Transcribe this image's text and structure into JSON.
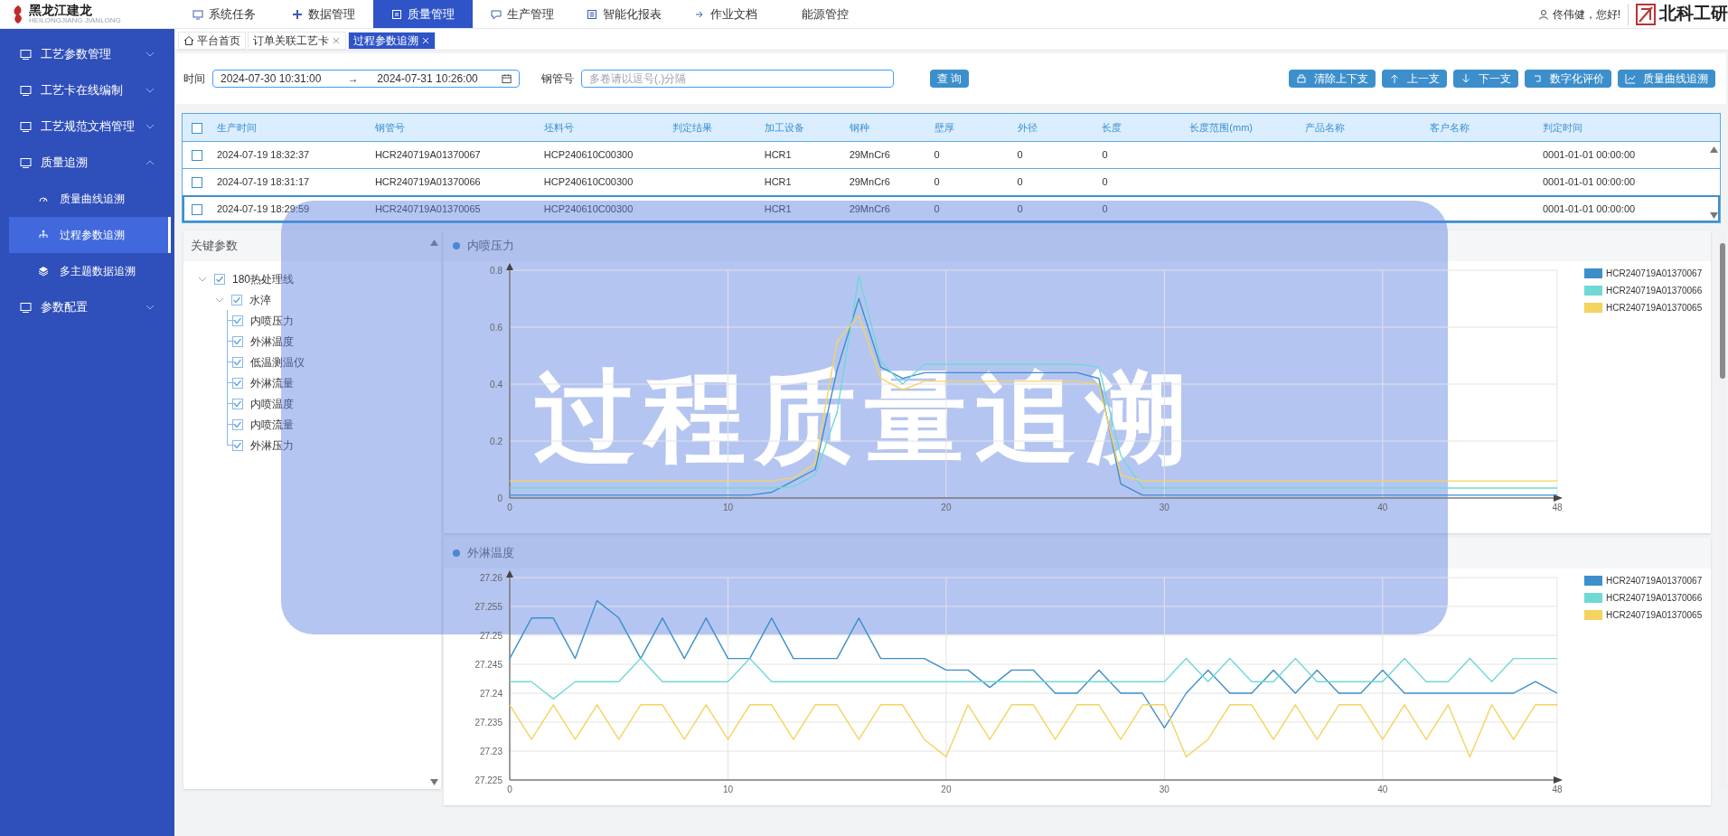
{
  "header": {
    "logo_text": "黑龙江建龙",
    "logo_subtitle": "HEILONGJIANG JIANLONG",
    "nav": [
      {
        "label": "系统任务",
        "has_icon": true,
        "selected": false
      },
      {
        "label": "数据管理",
        "has_icon": true,
        "selected": false
      },
      {
        "label": "质量管理",
        "has_icon": true,
        "selected": true
      },
      {
        "label": "生产管理",
        "has_icon": true,
        "selected": false
      },
      {
        "label": "智能化报表",
        "has_icon": true,
        "selected": false
      },
      {
        "label": "作业文档",
        "has_icon": true,
        "selected": false
      },
      {
        "label": "能源管控",
        "has_icon": false,
        "selected": false
      }
    ],
    "user_greeting": "佟伟健，您好!",
    "brand_text": "北科工研"
  },
  "sidebar": {
    "items": [
      {
        "label": "工艺参数管理",
        "expanded": false
      },
      {
        "label": "工艺卡在线编制",
        "expanded": false
      },
      {
        "label": "工艺规范文档管理",
        "expanded": false
      },
      {
        "label": "质量追溯",
        "expanded": true,
        "children": [
          {
            "label": "质量曲线追溯",
            "selected": false
          },
          {
            "label": "过程参数追溯",
            "selected": true
          },
          {
            "label": "多主题数据追溯",
            "selected": false
          }
        ]
      },
      {
        "label": "参数配置",
        "expanded": false
      }
    ]
  },
  "tabs": [
    {
      "label": "平台首页",
      "kind": "home",
      "selected": false
    },
    {
      "label": "订单关联工艺卡",
      "kind": "closable",
      "selected": false
    },
    {
      "label": "过程参数追溯",
      "kind": "closable",
      "selected": true
    }
  ],
  "filters": {
    "time_label": "时间",
    "start": "2024-07-30 10:31:00",
    "separator": "→",
    "end": "2024-07-31 10:26:00",
    "pipe_label": "钢管号",
    "pipe_placeholder": "多卷请以逗号(,)分隔",
    "query_button": "查 询"
  },
  "actions": [
    "清除上下支",
    "上一支",
    "下一支",
    "数字化评价",
    "质量曲线追溯"
  ],
  "table": {
    "header_checked": false,
    "columns": [
      "生产时间",
      "钢管号",
      "坯料号",
      "判定结果",
      "加工设备",
      "钢种",
      "壁厚",
      "外径",
      "长度",
      "长度范围(mm)",
      "产品名称",
      "客户名称",
      "判定时间"
    ],
    "rows": [
      {
        "selected": false,
        "checked": false,
        "cells": [
          "2024-07-19 18:32:37",
          "HCR240719A01370067",
          "HCP240610C00300",
          "",
          "HCR1",
          "29MnCr6",
          "0",
          "0",
          "0",
          "",
          "",
          "",
          "0001-01-01 00:00:00"
        ]
      },
      {
        "selected": false,
        "checked": false,
        "cells": [
          "2024-07-19 18:31:17",
          "HCR240719A01370066",
          "HCP240610C00300",
          "",
          "HCR1",
          "29MnCr6",
          "0",
          "0",
          "0",
          "",
          "",
          "",
          "0001-01-01 00:00:00"
        ]
      },
      {
        "selected": true,
        "checked": false,
        "cells": [
          "2024-07-19 18:29:59",
          "HCR240719A01370065",
          "HCP240610C00300",
          "",
          "HCR1",
          "29MnCr6",
          "0",
          "0",
          "0",
          "",
          "",
          "",
          "0001-01-01 00:00:00"
        ]
      }
    ]
  },
  "params": {
    "title": "关键参数",
    "tree": [
      {
        "label": "180热处理线",
        "checked": true,
        "expanded": true,
        "children": [
          {
            "label": "水淬",
            "checked": true,
            "expanded": true,
            "children": [
              {
                "label": "内喷压力",
                "checked": true
              },
              {
                "label": "外淋温度",
                "checked": true
              },
              {
                "label": "低温测温仪",
                "checked": true
              },
              {
                "label": "外淋流量",
                "checked": true
              },
              {
                "label": "内喷温度",
                "checked": true
              },
              {
                "label": "内喷流量",
                "checked": true
              },
              {
                "label": "外淋压力",
                "checked": true
              }
            ]
          }
        ]
      }
    ]
  },
  "charts": [
    {
      "title": "内喷压力",
      "chart_data": {
        "type": "line",
        "grid": true,
        "legend": true,
        "x": [
          0,
          1,
          2,
          3,
          4,
          5,
          6,
          7,
          8,
          9,
          10,
          11,
          12,
          13,
          14,
          15,
          16,
          17,
          18,
          19,
          20,
          21,
          22,
          23,
          24,
          25,
          26,
          27,
          28,
          29,
          30,
          31,
          32,
          33,
          34,
          35,
          36,
          37,
          38,
          39,
          40,
          41,
          42,
          43,
          44,
          45,
          46,
          47,
          48
        ],
        "xlim": [
          0,
          48
        ],
        "ylim": [
          0,
          0.8
        ],
        "xticks": [
          0,
          10,
          20,
          30,
          40,
          48
        ],
        "yticks": [
          0,
          0.2,
          0.4,
          0.6,
          0.8
        ],
        "series": [
          {
            "name": "HCR240719A01370067",
            "color": "#3d8fcc",
            "values": [
              0.01,
              0.01,
              0.01,
              0.01,
              0.01,
              0.01,
              0.01,
              0.01,
              0.01,
              0.01,
              0.01,
              0.01,
              0.02,
              0.06,
              0.1,
              0.45,
              0.7,
              0.46,
              0.42,
              0.44,
              0.44,
              0.44,
              0.44,
              0.44,
              0.44,
              0.44,
              0.44,
              0.42,
              0.05,
              0.01,
              0.01,
              0.01,
              0.01,
              0.01,
              0.01,
              0.01,
              0.01,
              0.01,
              0.01,
              0.01,
              0.01,
              0.01,
              0.01,
              0.01,
              0.01,
              0.01,
              0.01,
              0.01,
              0.01
            ]
          },
          {
            "name": "HCR240719A01370066",
            "color": "#6fd9d6",
            "values": [
              0.035,
              0.035,
              0.035,
              0.035,
              0.035,
              0.035,
              0.035,
              0.035,
              0.035,
              0.035,
              0.035,
              0.035,
              0.035,
              0.04,
              0.08,
              0.3,
              0.78,
              0.48,
              0.4,
              0.47,
              0.47,
              0.47,
              0.47,
              0.47,
              0.47,
              0.47,
              0.47,
              0.46,
              0.15,
              0.035,
              0.035,
              0.035,
              0.035,
              0.035,
              0.035,
              0.035,
              0.035,
              0.035,
              0.035,
              0.035,
              0.035,
              0.035,
              0.035,
              0.035,
              0.035,
              0.035,
              0.035,
              0.035,
              0.035
            ]
          },
          {
            "name": "HCR240719A01370065",
            "color": "#f4d35e",
            "values": [
              0.06,
              0.06,
              0.06,
              0.06,
              0.06,
              0.06,
              0.06,
              0.06,
              0.06,
              0.06,
              0.06,
              0.06,
              0.06,
              0.07,
              0.12,
              0.55,
              0.64,
              0.42,
              0.38,
              0.41,
              0.41,
              0.41,
              0.41,
              0.41,
              0.41,
              0.41,
              0.41,
              0.4,
              0.08,
              0.06,
              0.06,
              0.06,
              0.06,
              0.06,
              0.06,
              0.06,
              0.06,
              0.06,
              0.06,
              0.06,
              0.06,
              0.06,
              0.06,
              0.06,
              0.06,
              0.06,
              0.06,
              0.06,
              0.06
            ]
          }
        ]
      }
    },
    {
      "title": "外淋温度",
      "chart_data": {
        "type": "line",
        "grid": true,
        "legend": true,
        "x": [
          0,
          1,
          2,
          3,
          4,
          5,
          6,
          7,
          8,
          9,
          10,
          11,
          12,
          13,
          14,
          15,
          16,
          17,
          18,
          19,
          20,
          21,
          22,
          23,
          24,
          25,
          26,
          27,
          28,
          29,
          30,
          31,
          32,
          33,
          34,
          35,
          36,
          37,
          38,
          39,
          40,
          41,
          42,
          43,
          44,
          45,
          46,
          47,
          48
        ],
        "xlim": [
          0,
          48
        ],
        "ylim": [
          27.225,
          27.26
        ],
        "xticks": [
          0,
          10,
          20,
          30,
          40,
          48
        ],
        "yticks": [
          27.225,
          27.23,
          27.235,
          27.24,
          27.245,
          27.25,
          27.255,
          27.26
        ],
        "series": [
          {
            "name": "HCR240719A01370067",
            "color": "#3d8fcc",
            "values": [
              27.246,
              27.253,
              27.253,
              27.246,
              27.256,
              27.253,
              27.246,
              27.253,
              27.246,
              27.253,
              27.246,
              27.246,
              27.253,
              27.246,
              27.246,
              27.246,
              27.253,
              27.246,
              27.246,
              27.246,
              27.244,
              27.244,
              27.241,
              27.244,
              27.244,
              27.24,
              27.24,
              27.244,
              27.24,
              27.24,
              27.234,
              27.24,
              27.244,
              27.24,
              27.24,
              27.244,
              27.24,
              27.244,
              27.24,
              27.24,
              27.244,
              27.24,
              27.24,
              27.24,
              27.24,
              27.24,
              27.24,
              27.242,
              27.24
            ]
          },
          {
            "name": "HCR240719A01370066",
            "color": "#6fd9d6",
            "values": [
              27.242,
              27.242,
              27.239,
              27.242,
              27.242,
              27.242,
              27.246,
              27.242,
              27.242,
              27.242,
              27.242,
              27.246,
              27.242,
              27.242,
              27.242,
              27.242,
              27.242,
              27.242,
              27.242,
              27.242,
              27.242,
              27.242,
              27.242,
              27.242,
              27.242,
              27.242,
              27.242,
              27.242,
              27.242,
              27.242,
              27.242,
              27.246,
              27.242,
              27.246,
              27.242,
              27.242,
              27.246,
              27.242,
              27.242,
              27.242,
              27.242,
              27.246,
              27.242,
              27.242,
              27.246,
              27.242,
              27.246,
              27.246,
              27.246
            ]
          },
          {
            "name": "HCR240719A01370065",
            "color": "#f4d35e",
            "values": [
              27.238,
              27.232,
              27.238,
              27.232,
              27.238,
              27.232,
              27.238,
              27.238,
              27.232,
              27.238,
              27.232,
              27.238,
              27.238,
              27.232,
              27.238,
              27.238,
              27.232,
              27.238,
              27.238,
              27.232,
              27.229,
              27.238,
              27.232,
              27.238,
              27.238,
              27.232,
              27.238,
              27.238,
              27.232,
              27.238,
              27.238,
              27.229,
              27.232,
              27.238,
              27.238,
              27.232,
              27.238,
              27.232,
              27.238,
              27.238,
              27.232,
              27.238,
              27.232,
              27.238,
              27.229,
              27.238,
              27.232,
              27.238,
              27.238
            ]
          }
        ]
      }
    }
  ],
  "overlay_title": "过程质量追溯"
}
